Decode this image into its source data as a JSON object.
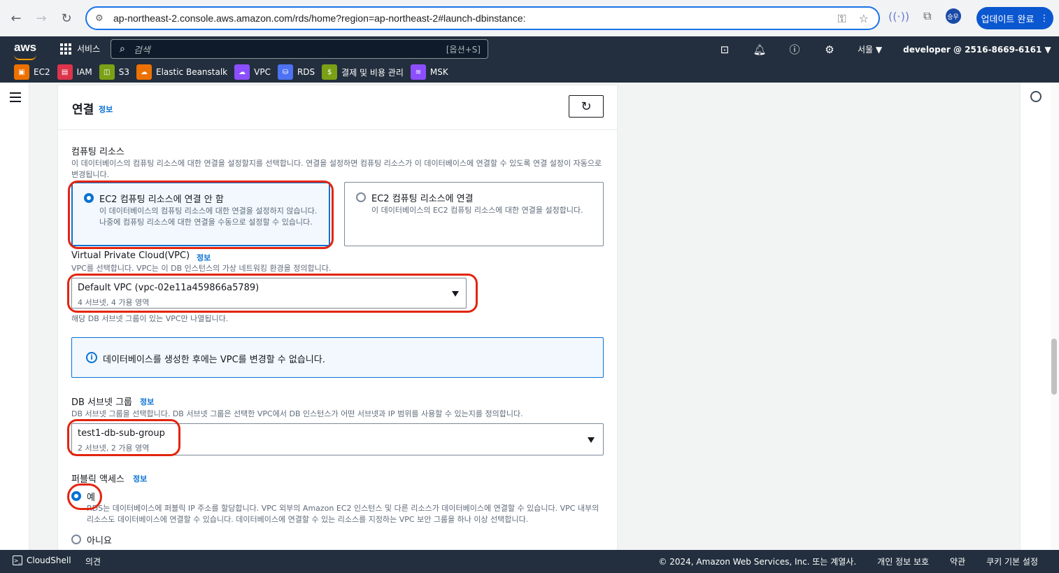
{
  "browser": {
    "url": "ap-northeast-2.console.aws.amazon.com/rds/home?region=ap-northeast-2#launch-dbinstance:",
    "profile_initials": "승우",
    "update_label": "업데이트 완료"
  },
  "aws_nav": {
    "logo": "aws",
    "services_label": "서비스",
    "search_placeholder": "검색",
    "search_shortcut": "[옵션+S]",
    "region": "서울 ▼",
    "account": "developer @ 2516-8669-6161 ▼",
    "favorites": [
      {
        "label": "EC2",
        "color": "#ed7100"
      },
      {
        "label": "IAM",
        "color": "#dd344c"
      },
      {
        "label": "S3",
        "color": "#7aa116"
      },
      {
        "label": "Elastic Beanstalk",
        "color": "#ed7100"
      },
      {
        "label": "VPC",
        "color": "#8c4fff"
      },
      {
        "label": "RDS",
        "color": "#4d72f3"
      },
      {
        "label": "결제 및 비용 관리",
        "color": "#7aa116"
      },
      {
        "label": "MSK",
        "color": "#8c4fff"
      }
    ]
  },
  "panel": {
    "title": "연결",
    "info": "정보",
    "compute": {
      "label": "컴퓨팅 리소스",
      "description": "이 데이터베이스의 컴퓨팅 리소스에 대한 연결을 설정할지를 선택합니다. 연결을 설정하면 컴퓨팅 리소스가 이 데이터베이스에 연결할 수 있도록 연결 설정이 자동으로 변경됩니다.",
      "option_no": {
        "title": "EC2 컴퓨팅 리소스에 연결 안 함",
        "description": "이 데이터베이스의 컴퓨팅 리소스에 대한 연결을 설정하지 않습니다. 나중에 컴퓨팅 리소스에 대한 연결을 수동으로 설정할 수 있습니다."
      },
      "option_yes": {
        "title": "EC2 컴퓨팅 리소스에 연결",
        "description": "이 데이터베이스의 EC2 컴퓨팅 리소스에 대한 연결을 설정합니다."
      }
    },
    "vpc": {
      "label": "Virtual Private Cloud(VPC)",
      "info": "정보",
      "description": "VPC를 선택합니다. VPC는 이 DB 인스턴스의 가상 네트워킹 환경을 정의합니다.",
      "selected": "Default VPC (vpc-02e11a459866a5789)",
      "selected_sub": "4 서브넷, 4 가용 영역",
      "hint": "해당 DB 서브넷 그룹이 있는 VPC만 나열됩니다."
    },
    "alert": "데이터베이스를 생성한 후에는 VPC를 변경할 수 없습니다.",
    "subnet": {
      "label": "DB 서브넷 그룹",
      "info": "정보",
      "description": "DB 서브넷 그룹을 선택합니다. DB 서브넷 그룹은 선택한 VPC에서 DB 인스턴스가 어떤 서브넷과 IP 범위를 사용할 수 있는지를 정의합니다.",
      "selected": "test1-db-sub-group",
      "selected_sub": "2 서브넷, 2 가용 영역"
    },
    "public": {
      "label": "퍼블릭 액세스",
      "info": "정보",
      "yes_label": "예",
      "yes_description": "RDS는 데이터베이스에 퍼블릭 IP 주소를 할당합니다. VPC 외부의 Amazon EC2 인스턴스 및 다른 리소스가 데이터베이스에 연결할 수 있습니다. VPC 내부의 리소스도 데이터베이스에 연결할 수 있습니다. 데이터베이스에 연결할 수 있는 리소스를 지정하는 VPC 보안 그룹을 하나 이상 선택합니다.",
      "no_label": "아니요"
    }
  },
  "footer": {
    "cloudshell": "CloudShell",
    "feedback": "의견",
    "copyright": "© 2024, Amazon Web Services, Inc. 또는 계열사.",
    "privacy": "개인 정보 보호",
    "terms": "약관",
    "cookies": "쿠키 기본 설정"
  },
  "colors": {
    "aws_nav": "#232f3e",
    "accent": "#0972d3",
    "highlight_ring": "#e2250f"
  }
}
